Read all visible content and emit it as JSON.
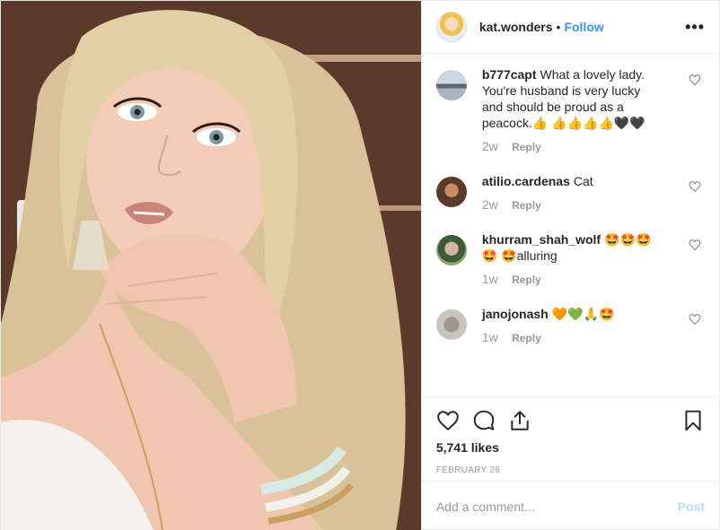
{
  "photo": {
    "icon": "portrait-photo"
  },
  "header": {
    "username": "kat.wonders",
    "separator": "•",
    "follow_label": "Follow",
    "more_label": "•••"
  },
  "comments": [
    {
      "user": "b777capt",
      "text": "What a lovely lady. You're husband is very lucky and should be proud as a peacock.👍 👍👍👍👍🖤🖤",
      "time": "2w",
      "reply": "Reply"
    },
    {
      "user": "atilio.cardenas",
      "text": "Cat",
      "time": "2w",
      "reply": "Reply"
    },
    {
      "user": "khurram_shah_wolf",
      "text": "🤩🤩🤩🤩 🤩alluring",
      "time": "1w",
      "reply": "Reply"
    },
    {
      "user": "janojonash",
      "text": "🧡💚🙏🤩",
      "time": "1w",
      "reply": "Reply"
    }
  ],
  "likes": "5,741 likes",
  "date": "FEBRUARY 26",
  "add_comment": {
    "placeholder": "Add a comment...",
    "post_label": "Post"
  },
  "colors": {
    "link": "#3897f0",
    "muted": "#999999",
    "post_disabled": "#b2dffc"
  }
}
